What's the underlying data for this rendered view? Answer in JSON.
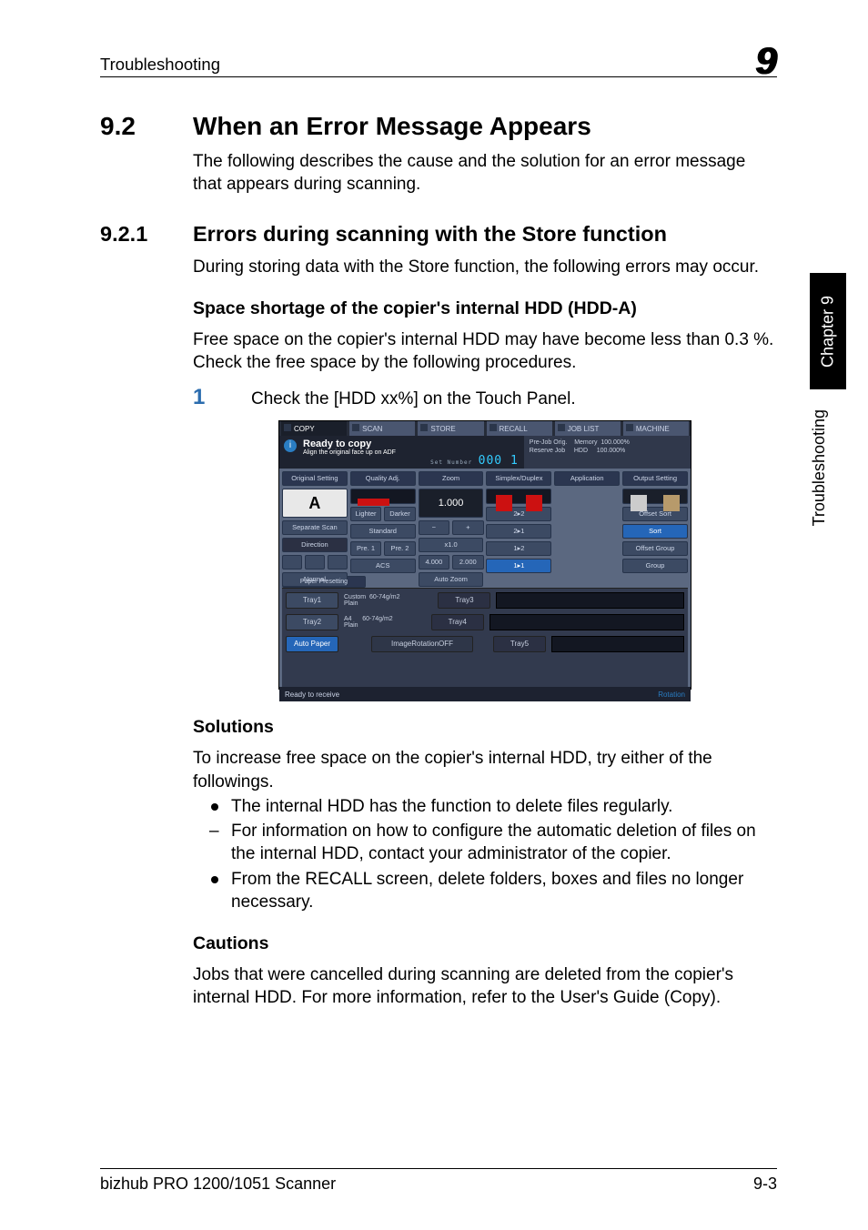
{
  "header": {
    "left": "Troubleshooting",
    "right": "9"
  },
  "side": {
    "chapter": "Chapter 9",
    "section": "Troubleshooting"
  },
  "h1": {
    "num": "9.2",
    "title": "When an Error Message Appears"
  },
  "intro": "The following describes the cause and the solution for an error message that appears during scanning.",
  "h2": {
    "num": "9.2.1",
    "title": "Errors during scanning with the Store function"
  },
  "p921": "During storing data with the Store function, the following errors may occur.",
  "h3_space": "Space shortage of the copier's internal HDD (HDD-A)",
  "p_space": "Free space on the copier's internal HDD may have become less than 0.3 %. Check the free space by the following procedures.",
  "step1": {
    "num": "1",
    "text": "Check the [HDD xx%] on the Touch Panel."
  },
  "h3_sol": "Solutions",
  "p_sol": "To increase free space on the copier's internal HDD, try either of the followings.",
  "bullets": {
    "b1": "The internal HDD has the function to delete files regularly.",
    "b2": "For information on how to configure the automatic deletion of files on the internal HDD, contact your administrator of the copier.",
    "b3": "From the RECALL screen, delete folders, boxes and files no longer necessary."
  },
  "h3_caution": "Cautions",
  "p_caution": "Jobs that were cancelled during scanning are deleted from the copier's internal HDD. For more information, refer to the User's Guide (Copy).",
  "footer": {
    "left": "bizhub PRO 1200/1051 Scanner",
    "right": "9-3"
  },
  "screenshot": {
    "tabs": {
      "copy": "COPY",
      "scan": "SCAN",
      "store": "STORE",
      "recall": "RECALL",
      "joblist": "JOB LIST",
      "machine": "MACHINE"
    },
    "status": {
      "title": "Ready to copy",
      "sub": "Align the original face up on ADF",
      "set_label": "Set Number",
      "set_value": "000 1",
      "right_l1": "Pre-Job Orig.",
      "right_l2": "Reserve Job",
      "right_mem": "Memory",
      "right_hdd": "HDD",
      "pct": "100.000%"
    },
    "row_heads": {
      "c1": "Original Setting",
      "c2": "Quality Adj.",
      "c3": "Zoom",
      "c4": "Simplex/Duplex",
      "c5": "Application",
      "c6": "Output Setting"
    },
    "col1": {
      "A": "A",
      "sep": "Separate Scan",
      "dir": "Direction",
      "normal": "Normal"
    },
    "col2": {
      "lighter": "Lighter",
      "darker": "Darker",
      "std": "Standard",
      "pre1": "Pre. 1",
      "pre2": "Pre. 2",
      "acs": "ACS"
    },
    "col3": {
      "val": "1.000",
      "minus": "−",
      "plus": "+",
      "x10": "x1.0",
      "r4000": "4.000",
      "r2000": "2.000",
      "auto": "Auto Zoom"
    },
    "col4": {
      "r22": "2▸2",
      "r21": "2▸1",
      "r12": "1▸2",
      "r11": "1▸1"
    },
    "col6": {
      "offsort": "Offset Sort",
      "sort": "Sort",
      "offgrp": "Offset Group",
      "grp": "Group"
    },
    "lower": {
      "paper_pre": "Paper Presetting",
      "tray1": "Tray1",
      "plain1": "Plain",
      "custom": "Custom",
      "gsm": "60-74g/m2",
      "tray2": "Tray2",
      "plain2": "Plain",
      "a4": "A4",
      "auto_paper": "Auto Paper",
      "rotoff": "ImageRotationOFF",
      "slot3": "Tray3",
      "slot4": "Tray4",
      "slot5": "Tray5"
    },
    "footer": {
      "ready": "Ready to receive",
      "rot": "Rotation"
    }
  }
}
